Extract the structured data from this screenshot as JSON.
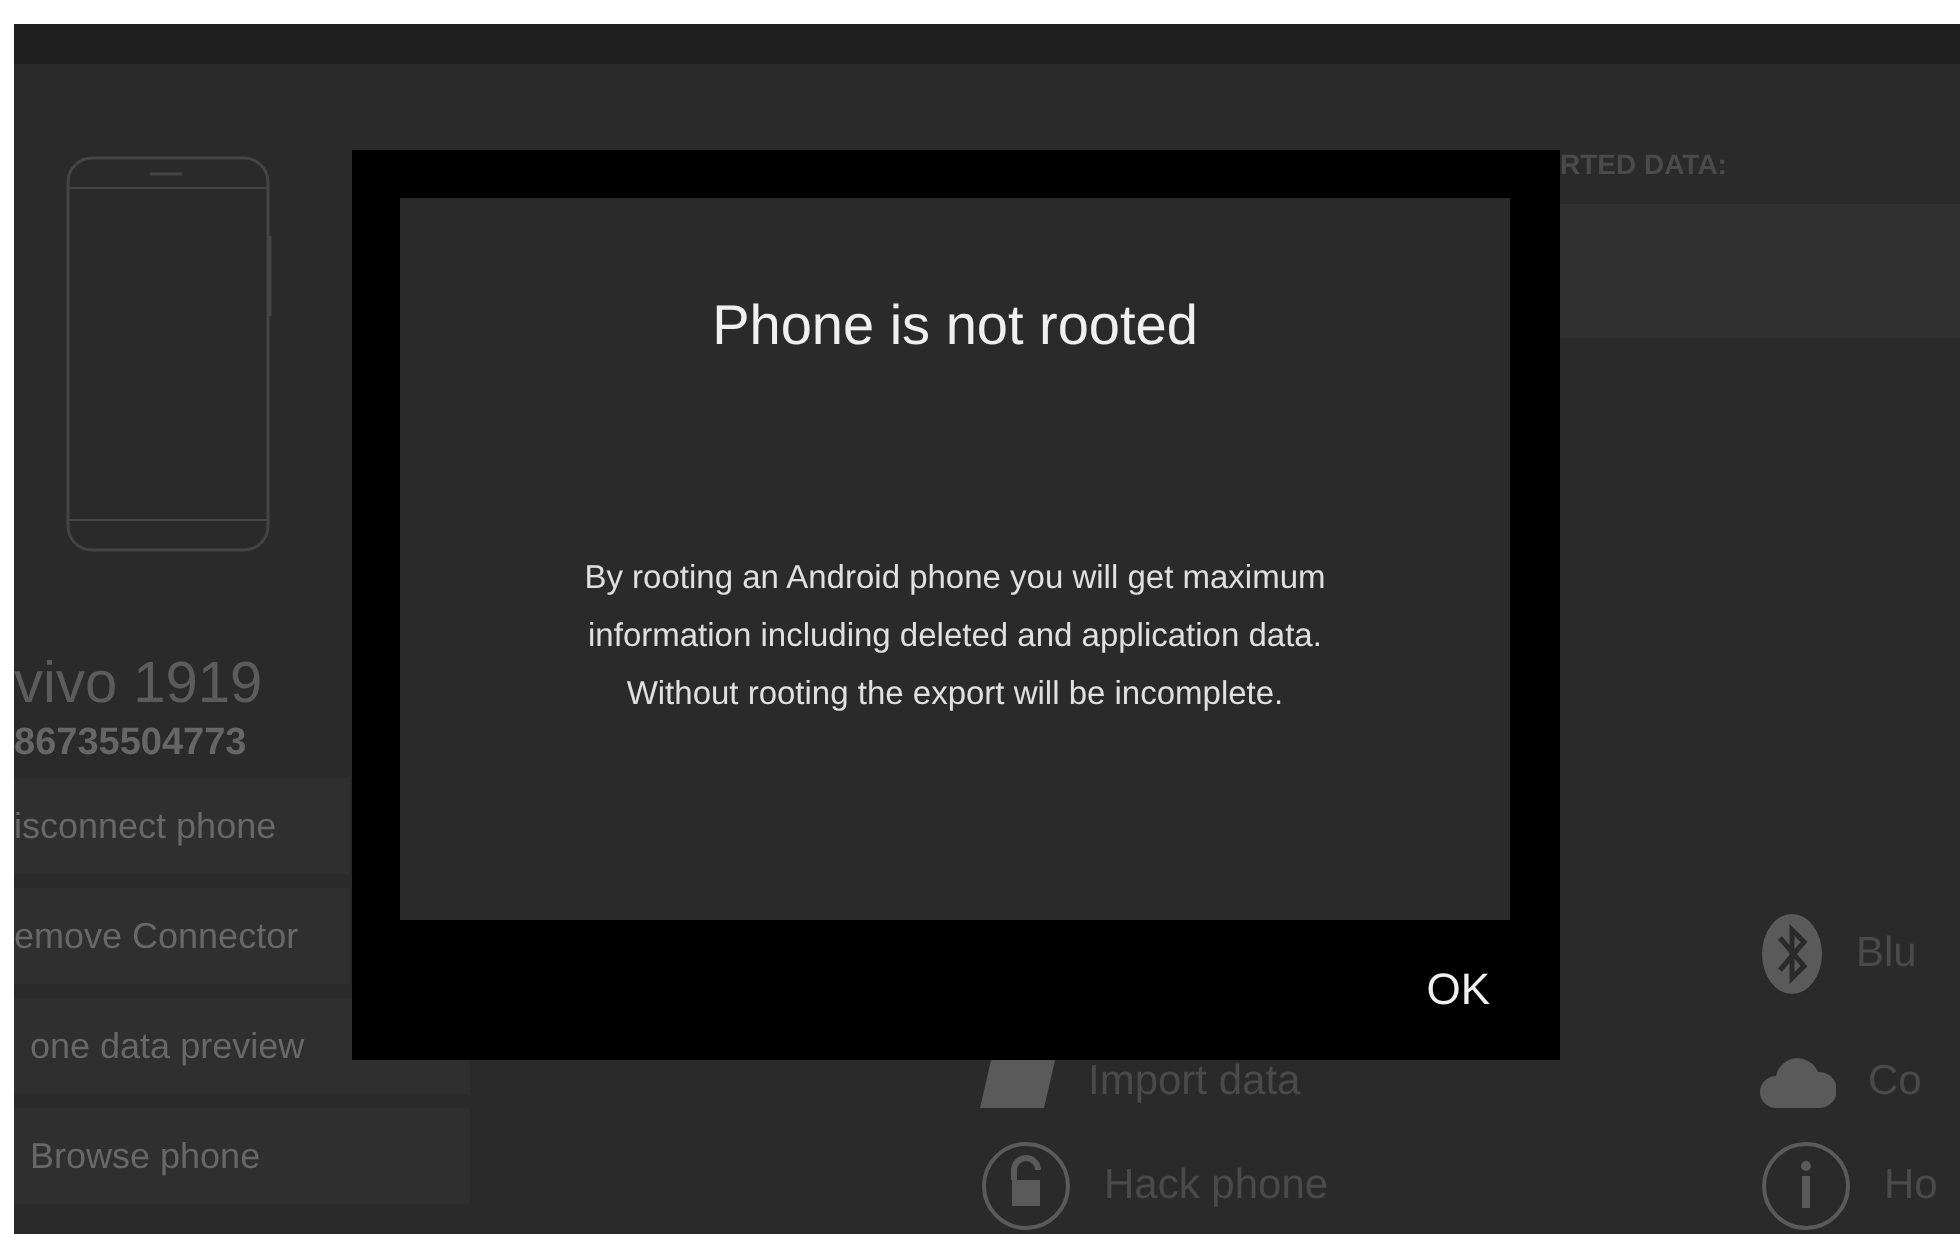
{
  "device": {
    "name": "vivo 1919",
    "imei": "86735504773"
  },
  "side_buttons": [
    "isconnect phone",
    "emove Connector",
    "one data preview",
    "Browse phone"
  ],
  "list_header": "RTED DATA:",
  "actions": [
    {
      "label": "Blu",
      "kind": "bluetooth"
    },
    {
      "label": "Import data",
      "kind": "folder"
    },
    {
      "label": "Co",
      "kind": "cloud"
    },
    {
      "label": "Hack phone",
      "kind": "lock"
    },
    {
      "label": "Ho",
      "kind": "info"
    }
  ],
  "dialog": {
    "title": "Phone is not rooted",
    "message": [
      "By rooting an Android phone you will get maximum",
      "information including deleted and application data.",
      "Without rooting the export will be incomplete."
    ],
    "button": "OK"
  }
}
